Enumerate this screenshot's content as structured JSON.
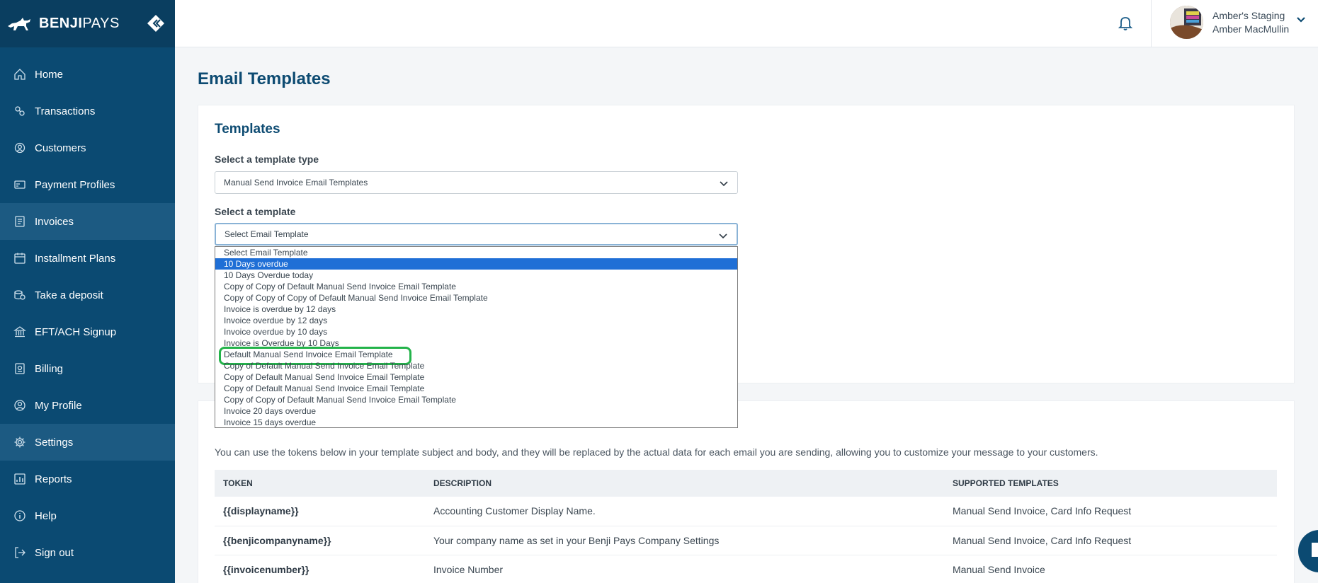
{
  "brand": {
    "bold": "BENJI",
    "light": "PAYS"
  },
  "sidebar": {
    "items": [
      {
        "label": "Home",
        "icon": "home-icon"
      },
      {
        "label": "Transactions",
        "icon": "transactions-icon"
      },
      {
        "label": "Customers",
        "icon": "customers-icon"
      },
      {
        "label": "Payment Profiles",
        "icon": "payment-profiles-icon"
      },
      {
        "label": "Invoices",
        "icon": "invoices-icon"
      },
      {
        "label": "Installment Plans",
        "icon": "calendar-icon"
      },
      {
        "label": "Take a deposit",
        "icon": "deposit-icon"
      },
      {
        "label": "EFT/ACH Signup",
        "icon": "bank-icon"
      },
      {
        "label": "Billing",
        "icon": "billing-icon"
      },
      {
        "label": "My Profile",
        "icon": "profile-icon"
      },
      {
        "label": "Settings",
        "icon": "gear-icon"
      },
      {
        "label": "Reports",
        "icon": "reports-icon"
      },
      {
        "label": "Help",
        "icon": "info-icon"
      },
      {
        "label": "Sign out",
        "icon": "sign-out-icon"
      }
    ]
  },
  "topbar": {
    "account_name": "Amber's Staging",
    "user_name": "Amber MacMullin"
  },
  "page": {
    "title": "Email Templates"
  },
  "templates": {
    "title": "Templates",
    "type_label": "Select a template type",
    "type_value": "Manual Send Invoice Email Templates",
    "template_label": "Select a template",
    "template_value": "Select Email Template",
    "options": [
      "Select Email Template",
      "10 Days overdue",
      "10 Days Overdue today",
      "Copy of Copy of Default Manual Send Invoice Email Template",
      "Copy of Copy of Copy of Default Manual Send Invoice Email Template",
      "Invoice is overdue by 12 days",
      "Invoice overdue by 12 days",
      "Invoice overdue by 10 days",
      "Invoice is Overdue by 10 Days",
      "Default Manual Send Invoice Email Template",
      "Copy of Default Manual Send Invoice Email Template",
      "Copy of Default Manual Send Invoice Email Template",
      "Copy of Default Manual Send Invoice Email Template",
      "Copy of Copy of Default Manual Send Invoice Email Template",
      "Invoice 20 days overdue",
      "Invoice 15 days overdue"
    ],
    "selected_index": 1,
    "ringed_index": 9
  },
  "tokens": {
    "description": "You can use the tokens below in your template subject and body, and they will be replaced by the actual data for each email you are sending, allowing you to customize your message to your customers.",
    "headers": [
      "TOKEN",
      "DESCRIPTION",
      "SUPPORTED TEMPLATES"
    ],
    "rows": [
      [
        "{{displayname}}",
        "Accounting Customer Display Name.",
        "Manual Send Invoice, Card Info Request"
      ],
      [
        "{{benjicompanyname}}",
        "Your company name as set in your Benji Pays Company Settings",
        "Manual Send Invoice, Card Info Request"
      ],
      [
        "{{invoicenumber}}",
        "Invoice Number",
        "Manual Send Invoice"
      ]
    ]
  },
  "colors": {
    "sidebar": "#0b4a72",
    "accent": "#0d4b72",
    "selected_option": "#1f6fd6",
    "ring": "#23b34a"
  }
}
